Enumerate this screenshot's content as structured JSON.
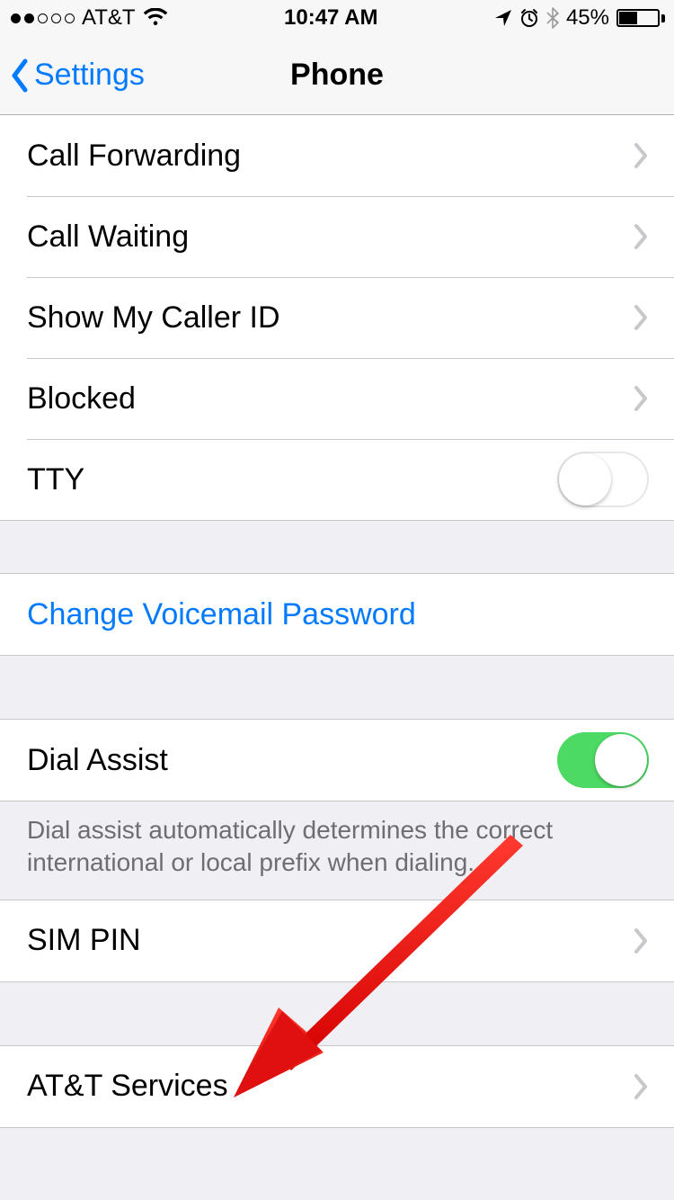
{
  "status": {
    "carrier": "AT&T",
    "time": "10:47 AM",
    "battery_pct": "45%"
  },
  "nav": {
    "back": "Settings",
    "title": "Phone"
  },
  "section1": {
    "call_forwarding": "Call Forwarding",
    "call_waiting": "Call Waiting",
    "show_caller_id": "Show My Caller ID",
    "blocked": "Blocked",
    "tty": "TTY"
  },
  "section2": {
    "change_vm_pw": "Change Voicemail Password"
  },
  "section3": {
    "dial_assist": "Dial Assist",
    "dial_assist_footer": "Dial assist automatically determines the correct international or local prefix when dialing."
  },
  "section4": {
    "sim_pin": "SIM PIN"
  },
  "section5": {
    "carrier_services": "AT&T Services"
  },
  "colors": {
    "link": "#007aff",
    "switch_on": "#4cd964",
    "arrow": "#ef1418"
  }
}
